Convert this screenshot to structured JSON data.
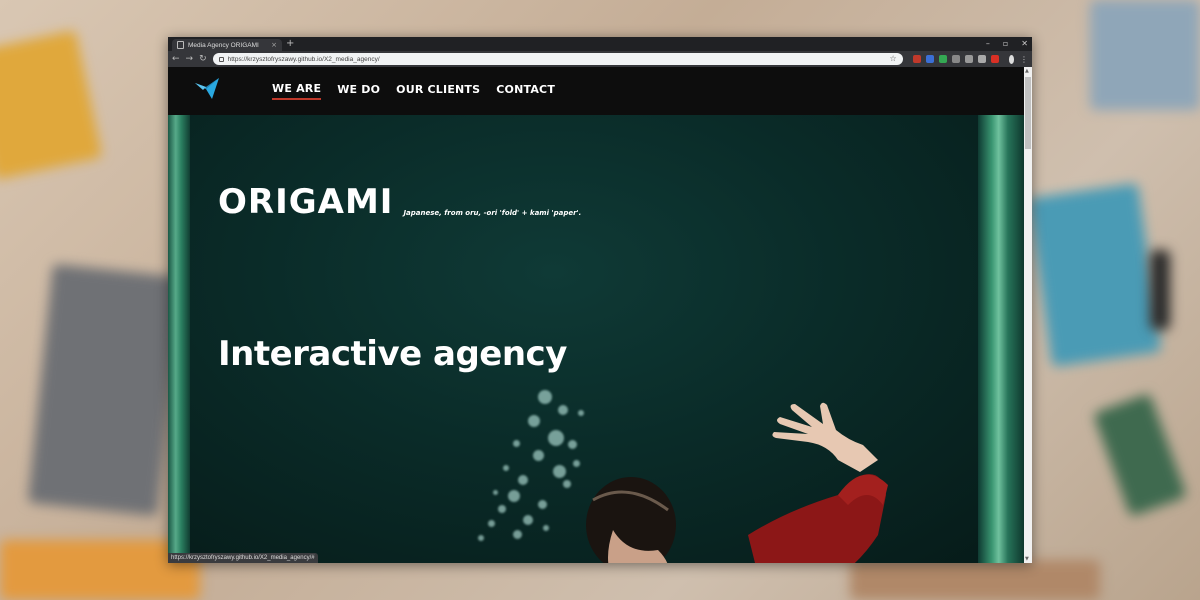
{
  "browser": {
    "tab_title": "Media Agency ORIGAMI",
    "url": "https://krzysztofryszawy.github.io/X2_media_agency/",
    "status_url": "https://krzysztofryszawy.github.io/X2_media_agency/#",
    "extensions": [
      "#c0392b",
      "#3b6fd6",
      "#34a853",
      "#888888",
      "#999999",
      "#aaaaaa",
      "#d93025"
    ]
  },
  "nav": {
    "items": [
      {
        "label": "WE ARE",
        "active": true
      },
      {
        "label": "WE DO"
      },
      {
        "label": "OUR CLIENTS"
      },
      {
        "label": "CONTACT"
      }
    ],
    "logo_icon": "origami-bird-icon"
  },
  "hero": {
    "brand": "ORIGAMI",
    "definition": "Japanese, from oru, -ori 'fold' + kami 'paper'.",
    "tagline": "Interactive agency"
  },
  "colors": {
    "accent": "#c0392b",
    "logo": "#29a8e0",
    "nav_bg": "#0d0d0d",
    "water": "#0a2b28"
  }
}
